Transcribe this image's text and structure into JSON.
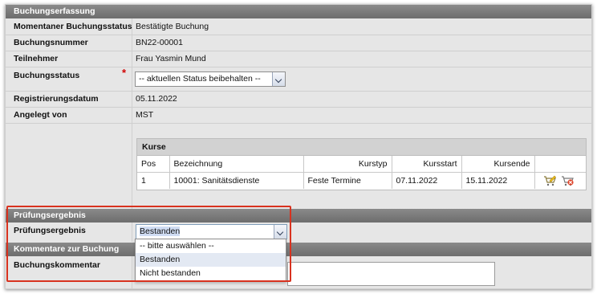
{
  "buchungserfassung": {
    "header": "Buchungserfassung",
    "rows": [
      {
        "label": "Momentaner Buchungsstatus",
        "value": "Bestätigte Buchung"
      },
      {
        "label": "Buchungsnummer",
        "value": "BN22-00001"
      },
      {
        "label": "Teilnehmer",
        "value": "Frau Yasmin Mund"
      },
      {
        "label": "Buchungsstatus",
        "value": ""
      },
      {
        "label": "Registrierungsdatum",
        "value": "05.11.2022"
      },
      {
        "label": "Angelegt von",
        "value": "MST"
      }
    ],
    "required_marker": "*",
    "status_select": "-- aktuellen Status beibehalten --"
  },
  "kurse": {
    "title": "Kurse",
    "columns": [
      "Pos",
      "Bezeichnung",
      "Kurstyp",
      "Kursstart",
      "Kursende"
    ],
    "rows": [
      {
        "pos": "1",
        "bezeichnung": "10001: Sanitätsdienste",
        "kurstyp": "Feste Termine",
        "kursstart": "07.11.2022",
        "kursende": "15.11.2022"
      }
    ],
    "row_icons": [
      "edit-cart-icon",
      "delete-cart-icon"
    ]
  },
  "pruefung": {
    "header": "Prüfungsergebnis",
    "label": "Prüfungsergebnis",
    "selected": "Bestanden",
    "options": [
      "-- bitte auswählen --",
      "Bestanden",
      "Nicht bestanden"
    ]
  },
  "kommentare": {
    "header": "Kommentare zur Buchung",
    "label": "Buchungskommentar"
  },
  "colors": {
    "section_header": "#7a7a7a",
    "highlight": "#d8321f",
    "required": "#d10000"
  }
}
